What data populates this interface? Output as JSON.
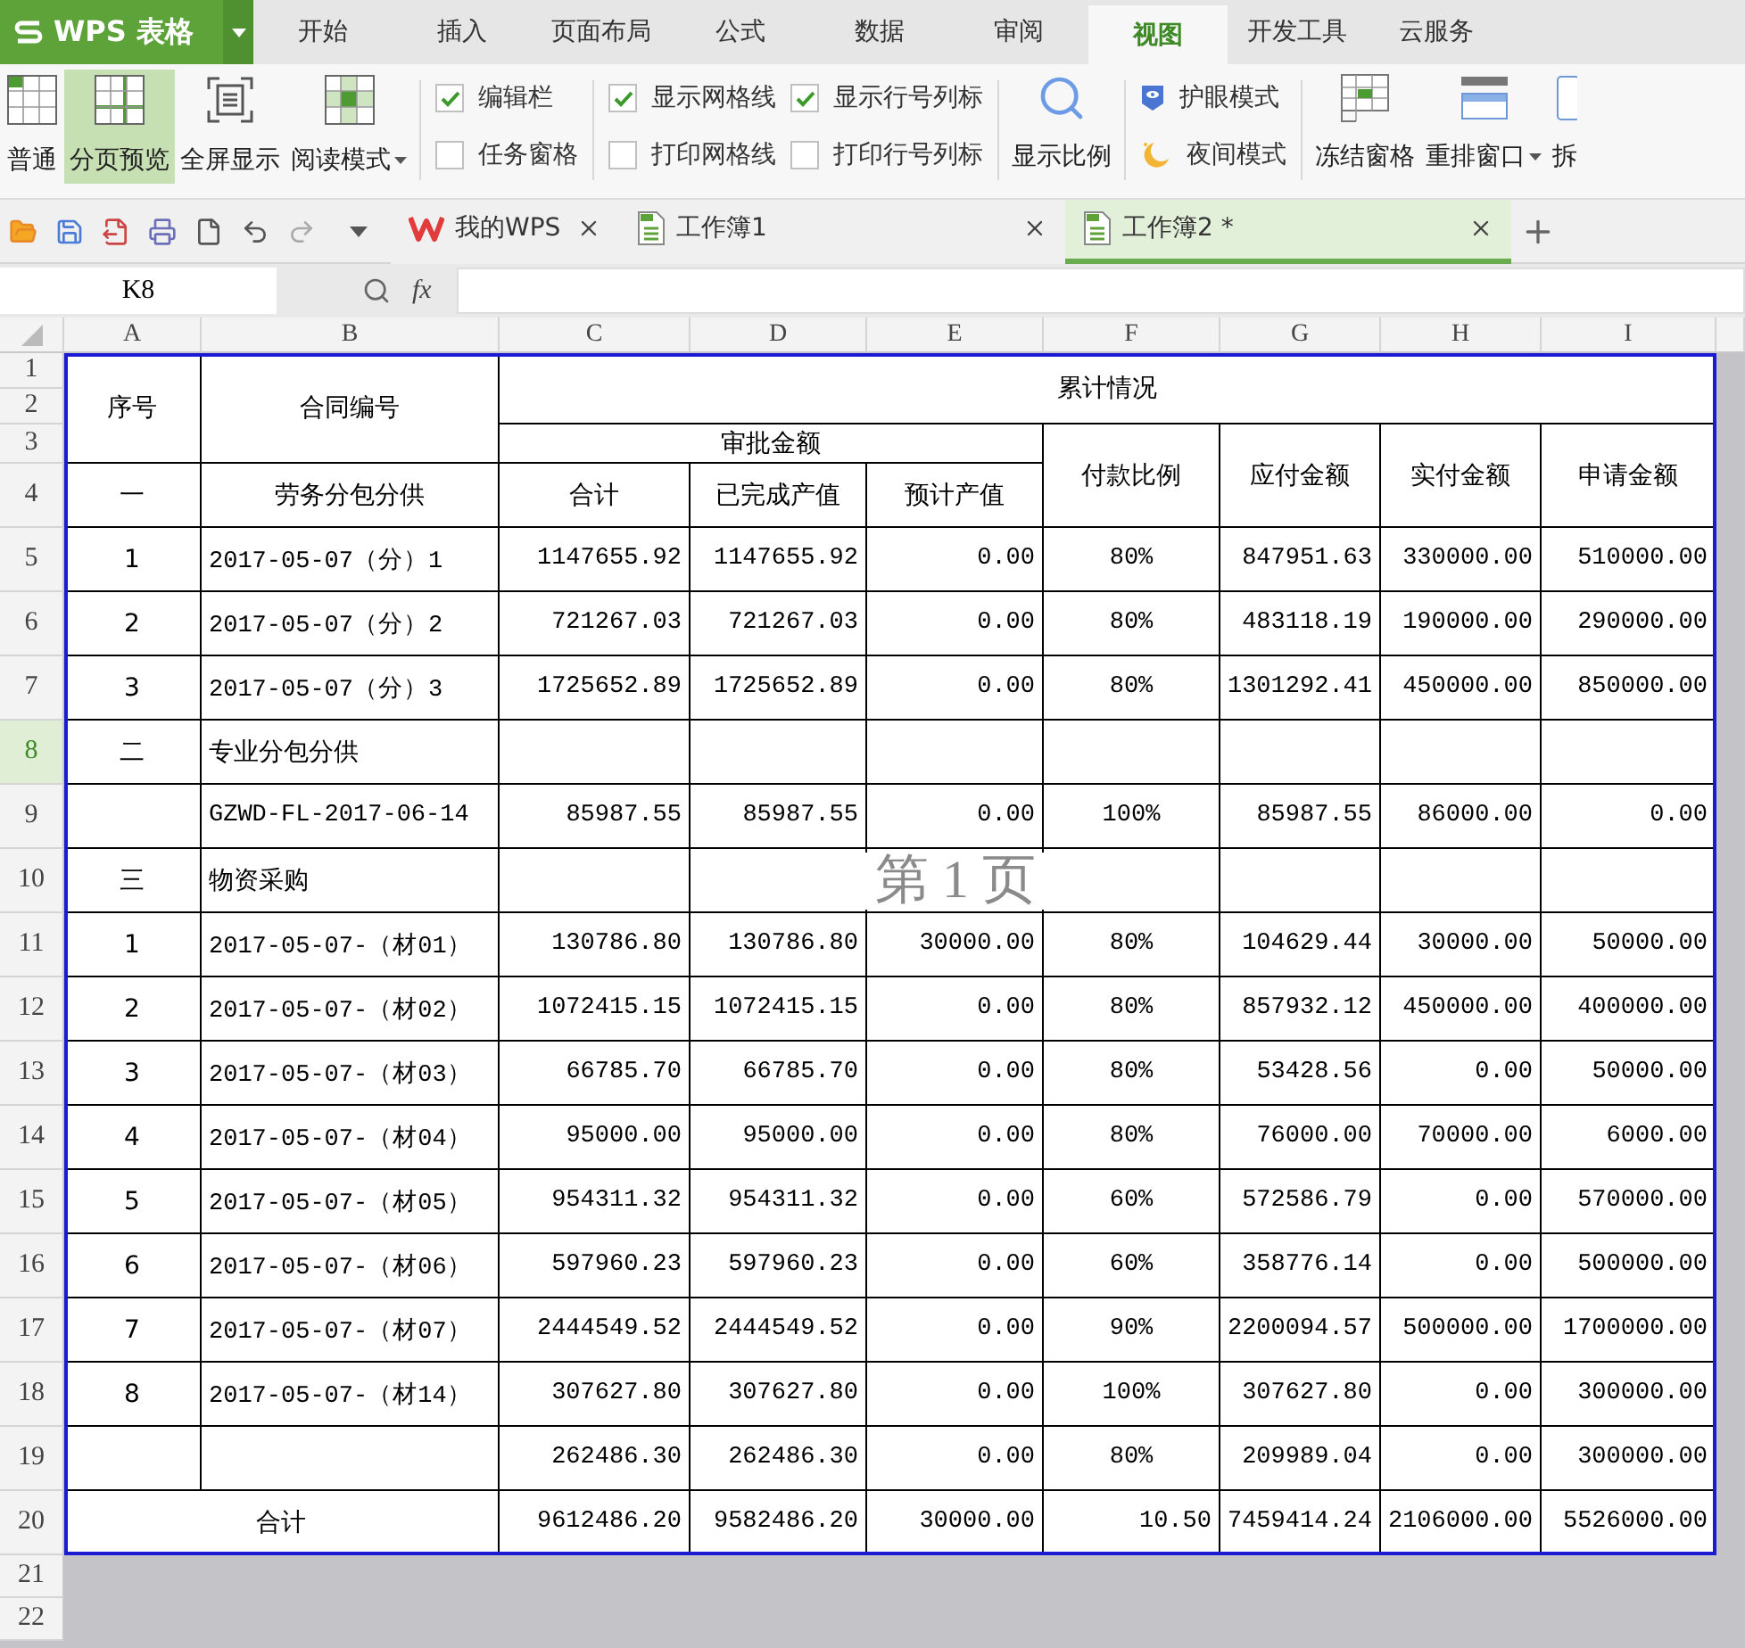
{
  "app": {
    "logo": "WPS 表格"
  },
  "menu_tabs": [
    {
      "label": "开始",
      "selected": false
    },
    {
      "label": "插入",
      "selected": false
    },
    {
      "label": "页面布局",
      "selected": false
    },
    {
      "label": "公式",
      "selected": false
    },
    {
      "label": "数据",
      "selected": false
    },
    {
      "label": "审阅",
      "selected": false
    },
    {
      "label": "视图",
      "selected": true
    },
    {
      "label": "开发工具",
      "selected": false
    },
    {
      "label": "云服务",
      "selected": false
    }
  ],
  "ribbon": {
    "view_modes": [
      {
        "label": "普通",
        "kind": "normal",
        "selected": false
      },
      {
        "label": "分页预览",
        "kind": "pagebreak",
        "selected": true
      },
      {
        "label": "全屏显示",
        "kind": "fullscreen",
        "selected": false
      },
      {
        "label": "阅读模式",
        "kind": "reading",
        "selected": false,
        "dropdown": true
      }
    ],
    "checkbox_columns": [
      [
        {
          "label": "编辑栏",
          "checked": true
        },
        {
          "label": "任务窗格",
          "checked": false
        }
      ],
      [
        {
          "label": "显示网格线",
          "checked": true
        },
        {
          "label": "打印网格线",
          "checked": false
        }
      ],
      [
        {
          "label": "显示行号列标",
          "checked": true
        },
        {
          "label": "打印行号列标",
          "checked": false
        }
      ]
    ],
    "zoom_button": {
      "label": "显示比例"
    },
    "mode_toggles": [
      {
        "label": "护眼模式",
        "kind": "eye"
      },
      {
        "label": "夜间模式",
        "kind": "night"
      }
    ],
    "window_buttons": [
      {
        "label": "冻结窗格",
        "kind": "freeze"
      },
      {
        "label": "重排窗口",
        "kind": "arrange",
        "dropdown": true
      },
      {
        "label": "拆",
        "kind": "split"
      }
    ]
  },
  "doc_tabs": [
    {
      "label": "我的WPS",
      "kind": "home",
      "selected": false
    },
    {
      "label": "工作簿1",
      "kind": "sheet",
      "selected": false
    },
    {
      "label": "工作簿2 *",
      "kind": "sheet",
      "selected": true
    }
  ],
  "formula_bar": {
    "cell_ref": "K8",
    "fx_label": "fx"
  },
  "sheet": {
    "columns": [
      "A",
      "B",
      "C",
      "D",
      "E",
      "F",
      "G",
      "H",
      "I"
    ],
    "rows": [
      {
        "label": "1",
        "selected": false
      },
      {
        "label": "2",
        "selected": false
      },
      {
        "label": "3",
        "selected": false
      },
      {
        "label": "4",
        "selected": false
      },
      {
        "label": "5",
        "selected": false
      },
      {
        "label": "6",
        "selected": false
      },
      {
        "label": "7",
        "selected": false
      },
      {
        "label": "8",
        "selected": true
      },
      {
        "label": "9",
        "selected": false
      },
      {
        "label": "10",
        "selected": false
      },
      {
        "label": "11",
        "selected": false
      },
      {
        "label": "12",
        "selected": false
      },
      {
        "label": "13",
        "selected": false
      },
      {
        "label": "14",
        "selected": false
      },
      {
        "label": "15",
        "selected": false
      },
      {
        "label": "16",
        "selected": false
      },
      {
        "label": "17",
        "selected": false
      },
      {
        "label": "18",
        "selected": false
      },
      {
        "label": "19",
        "selected": false
      },
      {
        "label": "20",
        "selected": false
      },
      {
        "label": "21",
        "selected": false
      },
      {
        "label": "22",
        "selected": false
      }
    ],
    "header": {
      "seq": "序号",
      "contract": "合同编号",
      "cumulative": "累计情况",
      "approved": "审批金额",
      "pay_ratio": "付款比例",
      "payable": "应付金额",
      "paid": "实付金额",
      "requested": "申请金额",
      "section_seq": "一",
      "section_name": "劳务分包分供",
      "total": "合计",
      "completed": "已完成产值",
      "estimated": "预计产值"
    },
    "data_rows": [
      {
        "kind": "data",
        "cells": [
          "1",
          "2017-05-07（分）1",
          "1147655.92",
          "1147655.92",
          "0.00",
          "80%",
          "847951.63",
          "330000.00",
          "510000.00"
        ]
      },
      {
        "kind": "data",
        "cells": [
          "2",
          "2017-05-07（分）2",
          "721267.03",
          "721267.03",
          "0.00",
          "80%",
          "483118.19",
          "190000.00",
          "290000.00"
        ]
      },
      {
        "kind": "data",
        "cells": [
          "3",
          "2017-05-07（分）3",
          "1725652.89",
          "1725652.89",
          "0.00",
          "80%",
          "1301292.41",
          "450000.00",
          "850000.00"
        ]
      },
      {
        "kind": "section",
        "cells": [
          "二",
          "专业分包分供",
          null,
          null,
          null,
          null,
          null,
          null,
          null
        ]
      },
      {
        "kind": "data",
        "cells": [
          null,
          "GZWD-FL-2017-06-14",
          "85987.55",
          "85987.55",
          "0.00",
          "100%",
          "85987.55",
          "86000.00",
          "0.00"
        ]
      },
      {
        "kind": "section",
        "cells": [
          "三",
          "物资采购",
          null,
          null,
          null,
          null,
          null,
          null,
          null
        ]
      },
      {
        "kind": "data",
        "cells": [
          "1",
          "2017-05-07-（材01）",
          "130786.80",
          "130786.80",
          "30000.00",
          "80%",
          "104629.44",
          "30000.00",
          "50000.00"
        ]
      },
      {
        "kind": "data",
        "cells": [
          "2",
          "2017-05-07-（材02）",
          "1072415.15",
          "1072415.15",
          "0.00",
          "80%",
          "857932.12",
          "450000.00",
          "400000.00"
        ]
      },
      {
        "kind": "data",
        "cells": [
          "3",
          "2017-05-07-（材03）",
          "66785.70",
          "66785.70",
          "0.00",
          "80%",
          "53428.56",
          "0.00",
          "50000.00"
        ]
      },
      {
        "kind": "data",
        "cells": [
          "4",
          "2017-05-07-（材04）",
          "95000.00",
          "95000.00",
          "0.00",
          "80%",
          "76000.00",
          "70000.00",
          "6000.00"
        ]
      },
      {
        "kind": "data",
        "cells": [
          "5",
          "2017-05-07-（材05）",
          "954311.32",
          "954311.32",
          "0.00",
          "60%",
          "572586.79",
          "0.00",
          "570000.00"
        ]
      },
      {
        "kind": "data",
        "cells": [
          "6",
          "2017-05-07-（材06）",
          "597960.23",
          "597960.23",
          "0.00",
          "60%",
          "358776.14",
          "0.00",
          "500000.00"
        ]
      },
      {
        "kind": "data",
        "cells": [
          "7",
          "2017-05-07-（材07）",
          "2444549.52",
          "2444549.52",
          "0.00",
          "90%",
          "2200094.57",
          "500000.00",
          "1700000.00"
        ]
      },
      {
        "kind": "data",
        "cells": [
          "8",
          "2017-05-07-（材14）",
          "307627.80",
          "307627.80",
          "0.00",
          "100%",
          "307627.80",
          "0.00",
          "300000.00"
        ]
      },
      {
        "kind": "data",
        "cells": [
          null,
          null,
          "262486.30",
          "262486.30",
          "0.00",
          "80%",
          "209989.04",
          "0.00",
          "300000.00"
        ]
      },
      {
        "kind": "total",
        "cells": [
          "合计",
          "9612486.20",
          "9582486.20",
          "30000.00",
          "10.50",
          "7459414.24",
          "2106000.00",
          "5526000.00"
        ]
      }
    ],
    "page_label": "第 1 页"
  }
}
